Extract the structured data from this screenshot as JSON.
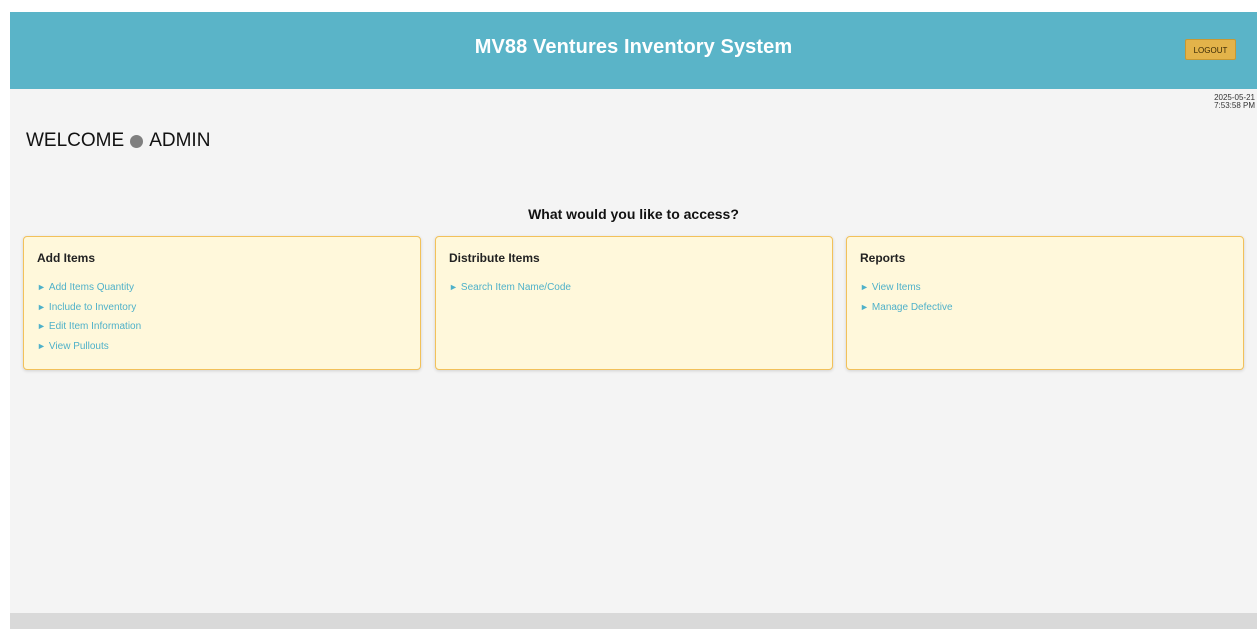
{
  "header": {
    "title": "MV88 Ventures Inventory System",
    "logout_label": "LOGOUT"
  },
  "datetime": {
    "date": "2025-05-21",
    "time": "7:53:58 PM"
  },
  "welcome": {
    "greeting": "WELCOME",
    "user": "ADMIN"
  },
  "prompt": "What would you like to access?",
  "cards": [
    {
      "title": "Add Items",
      "links": [
        "Add Items Quantity",
        "Include to Inventory",
        "Edit Item Information",
        "View Pullouts"
      ]
    },
    {
      "title": "Distribute Items",
      "links": [
        "Search Item Name/Code"
      ]
    },
    {
      "title": "Reports",
      "links": [
        "View Items",
        "Manage Defective"
      ]
    }
  ],
  "icons": {
    "link_arrow": "►",
    "status_dot": "●"
  },
  "colors": {
    "header": "#5ab4c8",
    "logout_button": "#e3b34a",
    "card_background": "#fff8db",
    "card_border": "#f2c15a",
    "link": "#4fb1c9"
  }
}
